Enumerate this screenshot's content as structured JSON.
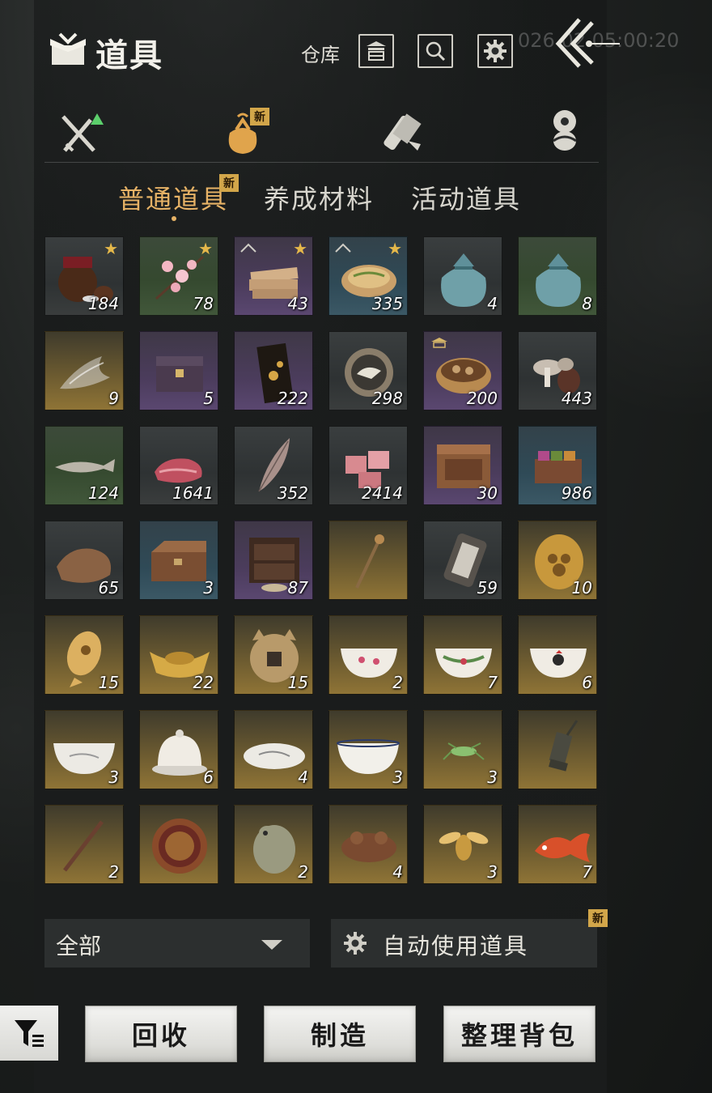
{
  "header": {
    "title": "道具",
    "warehouse_label": "仓库",
    "clock": "026 02 05:00:20"
  },
  "category_tabs": [
    {
      "name": "equipment",
      "icon": "crossed-swords-icon",
      "badge": ""
    },
    {
      "name": "items",
      "icon": "bundle-sack-icon",
      "badge": "新",
      "active": true
    },
    {
      "name": "scrolls",
      "icon": "scroll-icon",
      "badge": ""
    },
    {
      "name": "tokens",
      "icon": "coin-stack-icon",
      "badge": ""
    }
  ],
  "sub_tabs": {
    "tab1": "普通道具",
    "tab1_badge": "新",
    "tab2": "养成材料",
    "tab3": "活动道具"
  },
  "items": [
    {
      "icon": "wine-jars-icon",
      "count": "184",
      "quality": "gray",
      "star": true
    },
    {
      "icon": "plum-blossom-icon",
      "count": "78",
      "quality": "green",
      "star": true
    },
    {
      "icon": "biscuit-stack-icon",
      "count": "43",
      "quality": "purple",
      "star": true,
      "rank": true
    },
    {
      "icon": "noodle-dish-icon",
      "count": "335",
      "quality": "blue",
      "star": true,
      "rank": true
    },
    {
      "icon": "blue-pouch-icon",
      "count": "4",
      "quality": "gray"
    },
    {
      "icon": "blue-pouch-icon",
      "count": "8",
      "quality": "green"
    },
    {
      "icon": "ghost-wisp-icon",
      "count": "9",
      "quality": "gold"
    },
    {
      "icon": "treasure-chest-icon",
      "count": "5",
      "quality": "purple"
    },
    {
      "icon": "red-envelope-icon",
      "count": "222",
      "quality": "purple"
    },
    {
      "icon": "bird-medallion-icon",
      "count": "298",
      "quality": "gray"
    },
    {
      "icon": "stew-bowl-icon",
      "count": "200",
      "quality": "purple",
      "shop": true
    },
    {
      "icon": "mushrooms-icon",
      "count": "443",
      "quality": "gray"
    },
    {
      "icon": "fish-icon",
      "count": "124",
      "quality": "green"
    },
    {
      "icon": "raw-meat-icon",
      "count": "1641",
      "quality": "gray"
    },
    {
      "icon": "feather-icon",
      "count": "352",
      "quality": "gray"
    },
    {
      "icon": "meat-chunks-icon",
      "count": "2414",
      "quality": "gray"
    },
    {
      "icon": "carved-box-icon",
      "count": "30",
      "quality": "purple"
    },
    {
      "icon": "dye-box-icon",
      "count": "986",
      "quality": "blue"
    },
    {
      "icon": "fur-pelt-icon",
      "count": "65",
      "quality": "gray"
    },
    {
      "icon": "wooden-chest-icon",
      "count": "3",
      "quality": "blue"
    },
    {
      "icon": "tall-cabinet-icon",
      "count": "87",
      "quality": "purple"
    },
    {
      "icon": "hairpin-icon",
      "count": "",
      "quality": "gold"
    },
    {
      "icon": "iron-token-icon",
      "count": "59",
      "quality": "gray"
    },
    {
      "icon": "golden-walnut-icon",
      "count": "10",
      "quality": "gold"
    },
    {
      "icon": "fish-token-icon",
      "count": "15",
      "quality": "gold"
    },
    {
      "icon": "gold-ingot-icon",
      "count": "22",
      "quality": "gold"
    },
    {
      "icon": "cat-coin-icon",
      "count": "15",
      "quality": "gold"
    },
    {
      "icon": "floral-bowl-icon",
      "count": "2",
      "quality": "gold"
    },
    {
      "icon": "painted-bowl-icon",
      "count": "7",
      "quality": "gold"
    },
    {
      "icon": "rooster-bowl-icon",
      "count": "6",
      "quality": "gold"
    },
    {
      "icon": "white-bowl-icon",
      "count": "3",
      "quality": "gold"
    },
    {
      "icon": "covered-bowl-icon",
      "count": "6",
      "quality": "gold"
    },
    {
      "icon": "plate-icon",
      "count": "4",
      "quality": "gold"
    },
    {
      "icon": "blue-rim-bowl-icon",
      "count": "3",
      "quality": "gold"
    },
    {
      "icon": "cricket-icon",
      "count": "3",
      "quality": "gold"
    },
    {
      "icon": "bronze-bell-icon",
      "count": "",
      "quality": "gold"
    },
    {
      "icon": "brush-stick-icon",
      "count": "2",
      "quality": "gold"
    },
    {
      "icon": "lacquer-box-icon",
      "count": "",
      "quality": "gold"
    },
    {
      "icon": "clay-ocarina-icon",
      "count": "2",
      "quality": "gold"
    },
    {
      "icon": "toad-figure-icon",
      "count": "4",
      "quality": "gold"
    },
    {
      "icon": "golden-bee-icon",
      "count": "3",
      "quality": "gold"
    },
    {
      "icon": "goldfish-icon",
      "count": "7",
      "quality": "gold"
    }
  ],
  "controls": {
    "filter_label": "全部",
    "auto_use_label": "自动使用道具",
    "auto_use_badge": "新",
    "recycle_label": "回收",
    "craft_label": "制造",
    "sort_label": "整理背包"
  },
  "colors": {
    "accent": "#e6b266",
    "badge": "#d2a64a",
    "star": "#e5b84a"
  }
}
